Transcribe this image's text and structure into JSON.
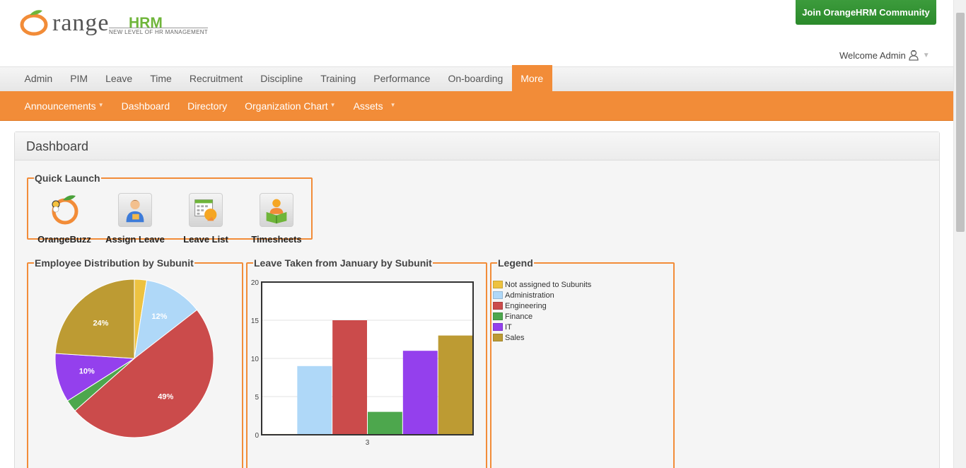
{
  "header": {
    "logo_main": "range",
    "logo_hrm": "HRM",
    "logo_tagline": "NEW LEVEL OF HR MANAGEMENT",
    "community_button": "Join OrangeHRM Community",
    "welcome_text": "Welcome Admin",
    "user_icon": "user-icon",
    "caret": "▼"
  },
  "mainnav": {
    "items": [
      "Admin",
      "PIM",
      "Leave",
      "Time",
      "Recruitment",
      "Discipline",
      "Training",
      "Performance",
      "On-boarding",
      "More"
    ],
    "active": "More"
  },
  "subnav": {
    "items": [
      {
        "label": "Announcements",
        "dropdown": true
      },
      {
        "label": "Dashboard",
        "dropdown": false
      },
      {
        "label": "Directory",
        "dropdown": false
      },
      {
        "label": "Organization Chart",
        "dropdown": true
      },
      {
        "label": "Assets",
        "dropdown": true
      }
    ],
    "arrow": "▼"
  },
  "dashboard": {
    "title": "Dashboard",
    "quick_launch": {
      "legend": "Quick Launch",
      "items": [
        {
          "label": "OrangeBuzz",
          "icon": "orangebuzz-icon"
        },
        {
          "label": "Assign Leave",
          "icon": "assign-leave-icon"
        },
        {
          "label": "Leave List",
          "icon": "leave-list-icon"
        },
        {
          "label": "Timesheets",
          "icon": "timesheets-icon"
        }
      ]
    },
    "employee_distribution": {
      "legend": "Employee Distribution by Subunit"
    },
    "leave_taken": {
      "legend": "Leave Taken from January by Subunit"
    },
    "legend": {
      "legend": "Legend"
    }
  },
  "colors": {
    "orange": "#f28c38",
    "green": "#2b8a2b",
    "not_assigned": "#edc240",
    "administration": "#afd8f8",
    "engineering": "#cb4b4b",
    "finance": "#4da74d",
    "it": "#9440ed",
    "sales": "#bd9b33"
  },
  "chart_data": [
    {
      "type": "pie",
      "title": "Employee Distribution by Subunit",
      "labels": [
        "Not assigned to Subunits",
        "Administration",
        "Engineering",
        "Finance",
        "IT",
        "Sales"
      ],
      "values": [
        2.5,
        12,
        49,
        2.5,
        10,
        24
      ],
      "value_labels": [
        "",
        "12%",
        "49%",
        "",
        "10%",
        "24%"
      ],
      "colors": [
        "#edc240",
        "#afd8f8",
        "#cb4b4b",
        "#4da74d",
        "#9440ed",
        "#bd9b33"
      ]
    },
    {
      "type": "bar",
      "title": "Leave Taken from January by Subunit",
      "categories": [
        "3"
      ],
      "series": [
        {
          "name": "Not assigned to Subunits",
          "values": [
            0.1
          ]
        },
        {
          "name": "Administration",
          "values": [
            9
          ]
        },
        {
          "name": "Engineering",
          "values": [
            15
          ]
        },
        {
          "name": "Finance",
          "values": [
            3
          ]
        },
        {
          "name": "IT",
          "values": [
            11
          ]
        },
        {
          "name": "Sales",
          "values": [
            13
          ]
        }
      ],
      "ylim": [
        0,
        20
      ],
      "yticks": [
        0,
        5,
        10,
        15,
        20
      ],
      "grid": true
    }
  ]
}
